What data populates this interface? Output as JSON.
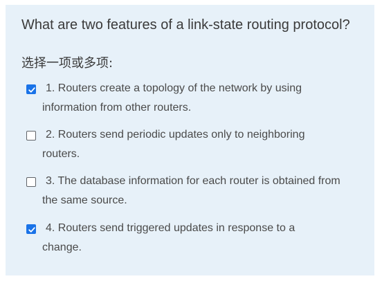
{
  "question": "What are two features of a link-state routing protocol?",
  "instruction": "选择一项或多项:",
  "options": [
    {
      "line1": "1. Routers create a topology of the network by using",
      "line2": "information from other routers.",
      "checked": true
    },
    {
      "line1": "2. Routers send periodic updates only to neighboring",
      "line2": "routers.",
      "checked": false
    },
    {
      "line1": "3. The database information for each router is obtained from",
      "line2": "the same source.",
      "checked": false
    },
    {
      "line1": "4. Routers send triggered updates in response to a",
      "line2": "change.",
      "checked": true
    }
  ],
  "colors": {
    "card_background": "#e7f1f9",
    "checkbox_checked": "#1a73e8"
  }
}
